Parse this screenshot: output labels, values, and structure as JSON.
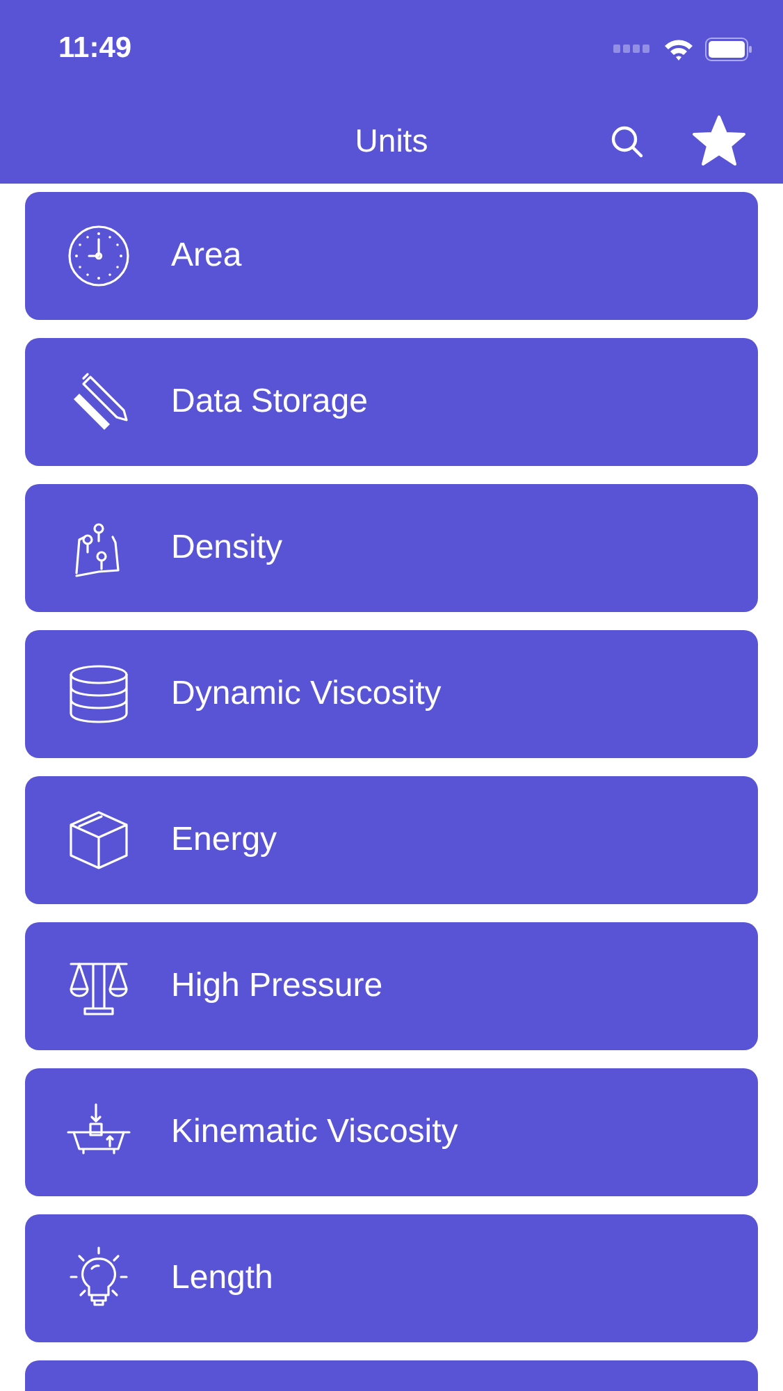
{
  "status_bar": {
    "time": "11:49"
  },
  "nav_bar": {
    "title": "Units"
  },
  "items": [
    {
      "label": "Area"
    },
    {
      "label": "Data Storage"
    },
    {
      "label": "Density"
    },
    {
      "label": "Dynamic Viscosity"
    },
    {
      "label": "Energy"
    },
    {
      "label": "High Pressure"
    },
    {
      "label": "Kinematic Viscosity"
    },
    {
      "label": "Length"
    }
  ],
  "more_below": true
}
